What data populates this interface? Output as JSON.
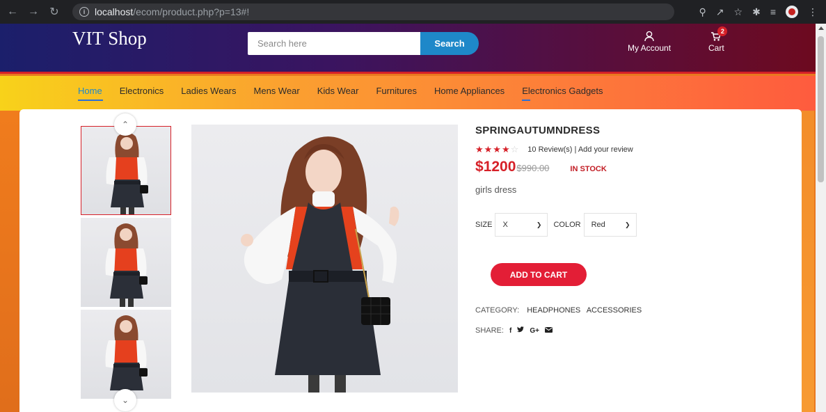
{
  "browser": {
    "url_host": "localhost",
    "url_path": "/ecom/product.php?p=13#!"
  },
  "header": {
    "logo": "VIT Shop",
    "search_placeholder": "Search here",
    "search_button": "Search",
    "account_label": "My Account",
    "cart_label": "Cart",
    "cart_count": "2"
  },
  "nav": {
    "items": [
      "Home",
      "Electronics",
      "Ladies Wears",
      "Mens Wear",
      "Kids Wear",
      "Furnitures",
      "Home Appliances",
      "Electronics Gadgets"
    ],
    "active": "Home"
  },
  "product": {
    "title": "SPRINGAUTUMNDRESS",
    "rating": 4,
    "rating_max": 5,
    "reviews_text": "10 Review(s) | Add your review",
    "price": "$1200",
    "old_price": "$990.00",
    "stock": "IN STOCK",
    "description": "girls dress",
    "size_label": "SIZE",
    "size_value": "X",
    "color_label": "COLOR",
    "color_value": "Red",
    "add_to_cart": "ADD TO CART",
    "category_label": "CATEGORY:",
    "categories": [
      "HEADPHONES",
      "ACCESSORIES"
    ],
    "share_label": "SHARE:",
    "share_icons": [
      "f",
      "❚",
      "G+",
      "✉"
    ]
  },
  "colors": {
    "accent_red": "#d62028",
    "accent_blue": "#1e88c9"
  }
}
